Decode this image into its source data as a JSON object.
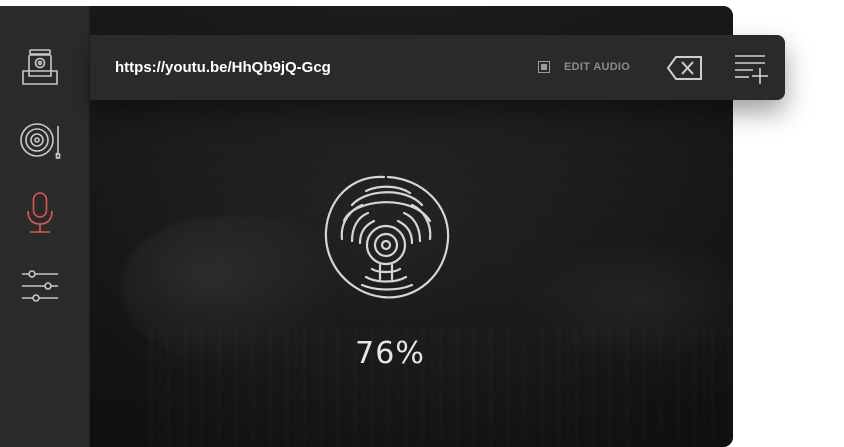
{
  "toolbar": {
    "url": "https://youtu.be/HhQb9jQ-Gcg",
    "edit_audio_label": "EDIT AUDIO",
    "edit_audio_checked": true
  },
  "sidebar": {
    "items": [
      {
        "icon": "inbox-download-icon",
        "active": false
      },
      {
        "icon": "turntable-icon",
        "active": false
      },
      {
        "icon": "microphone-icon",
        "active": true
      },
      {
        "icon": "sliders-icon",
        "active": false
      }
    ]
  },
  "progress": {
    "percent_label": "76%",
    "value": 76
  },
  "colors": {
    "accent": "#e0554f",
    "icon": "#c8c8c8",
    "text": "#ffffff",
    "muted": "#8a8a8a"
  }
}
